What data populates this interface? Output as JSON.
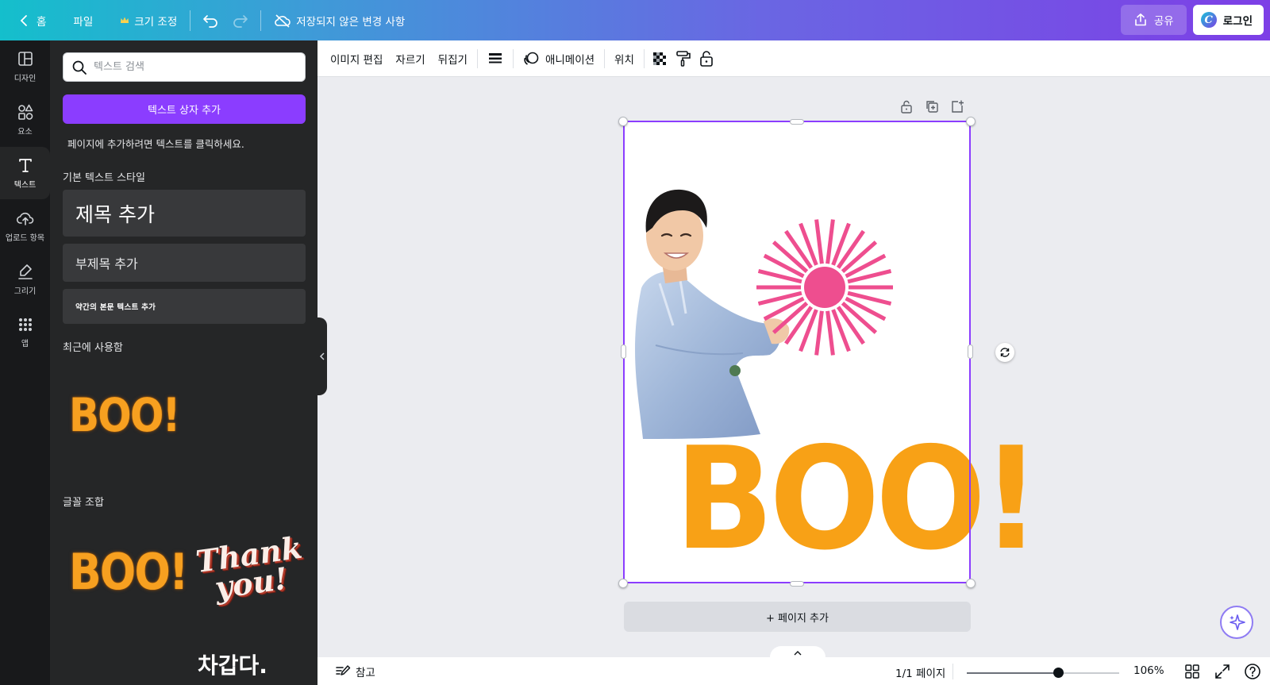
{
  "topbar": {
    "home_label": "홈",
    "file_label": "파일",
    "resize_label": "크기 조정",
    "save_status": "저장되지 않은 변경 사항",
    "share_label": "공유",
    "login_label": "로그인"
  },
  "rail": {
    "items": [
      {
        "label": "디자인",
        "icon": "layout-icon"
      },
      {
        "label": "요소",
        "icon": "shapes-icon"
      },
      {
        "label": "텍스트",
        "icon": "text-icon"
      },
      {
        "label": "업로드 항목",
        "icon": "upload-cloud-icon"
      },
      {
        "label": "그리기",
        "icon": "draw-icon"
      },
      {
        "label": "앱",
        "icon": "apps-grid-icon"
      }
    ],
    "active_item": "텍스트"
  },
  "panel": {
    "search_placeholder": "텍스트 검색",
    "add_textbox_label": "텍스트 상자 추가",
    "hint": "페이지에 추가하려면 텍스트를 클릭하세요.",
    "default_styles_title": "기본 텍스트 스타일",
    "heading_sample": "제목 추가",
    "subheading_sample": "부제목 추가",
    "body_sample": "약간의 본문 텍스트 추가",
    "recent_title": "최근에 사용함",
    "recent_boo": "BOO!",
    "font_combos_title": "글꼴 조합",
    "combo_boo": "BOO!",
    "combo_thank_line1": "Thank",
    "combo_thank_line2": "you!",
    "combo_chilled": "차갑다."
  },
  "toolbar": {
    "edit_image": "이미지 편집",
    "crop": "자르기",
    "flip": "뒤집기",
    "animate": "애니메이션",
    "position": "위치"
  },
  "canvas": {
    "boo_text": "BOO!",
    "add_page_label": "+ 페이지 추가"
  },
  "bottombar": {
    "notes_label": "참고",
    "page_counter": "1/1 페이지",
    "zoom_label": "106%",
    "zoom_fraction": 0.6
  },
  "colors": {
    "accent_purple": "#8b3dff",
    "boo_orange": "#f8a116",
    "burst_pink": "#ee4e8f",
    "panel_bg": "#252627",
    "rail_bg": "#18191b"
  }
}
